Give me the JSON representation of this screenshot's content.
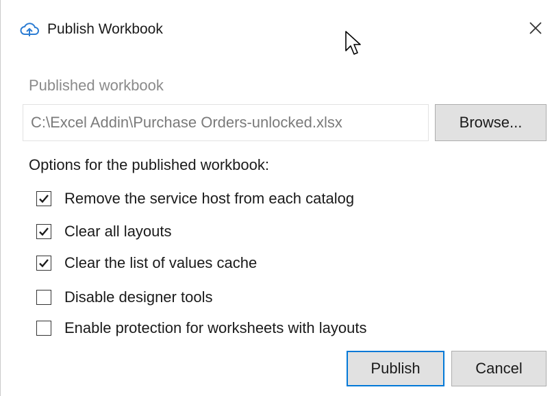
{
  "window": {
    "title": "Publish Workbook",
    "title_icon": "cloud-publish-icon",
    "close_icon": "close-icon"
  },
  "form": {
    "section_label": "Published workbook",
    "path_value": "C:\\Excel Addin\\Purchase Orders-unlocked.xlsx",
    "browse_label": "Browse...",
    "options_heading": "Options for the published workbook:",
    "options": [
      {
        "label": "Remove the service host from each catalog",
        "checked": true
      },
      {
        "label": "Clear all layouts",
        "checked": true
      },
      {
        "label": "Clear the list of values cache",
        "checked": true
      },
      {
        "label": "Disable designer tools",
        "checked": false
      },
      {
        "label": "Enable protection for worksheets with layouts",
        "checked": false
      }
    ]
  },
  "footer": {
    "publish_label": "Publish",
    "cancel_label": "Cancel"
  },
  "colors": {
    "accent": "#0078d7",
    "button_bg": "#e1e1e1",
    "muted_text": "#8a8a8a"
  }
}
